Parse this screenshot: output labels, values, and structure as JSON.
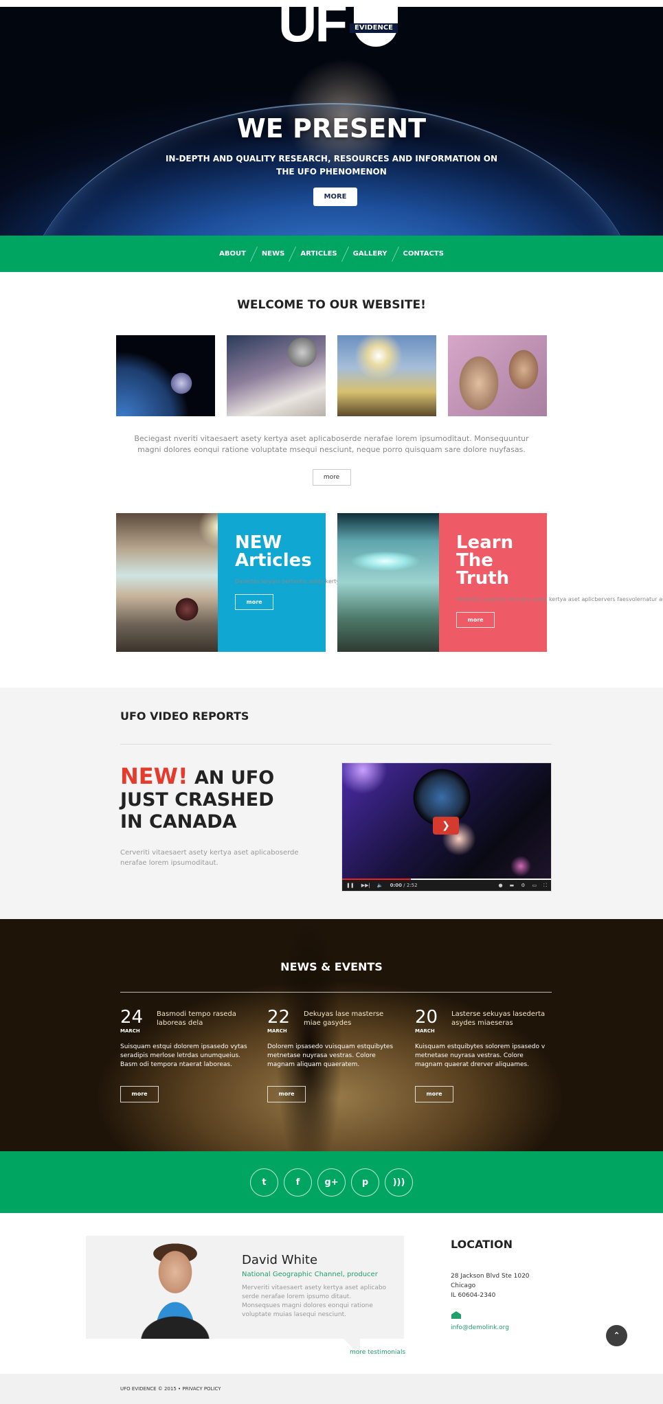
{
  "logo": {
    "main": "UFO",
    "tag": "EVIDENCE"
  },
  "hero": {
    "title": "WE PRESENT",
    "subtitle_line1": "IN-DEPTH AND QUALITY RESEARCH, RESOURCES AND INFORMATION ON",
    "subtitle_line2": "THE UFO PHENOMENON",
    "button": "MORE"
  },
  "nav": {
    "items": [
      "ABOUT",
      "NEWS",
      "ARTICLES",
      "GALLERY",
      "CONTACTS"
    ]
  },
  "welcome": {
    "title": "WELCOME TO OUR WEBSITE!",
    "text": "Beciegast nveriti vitaesaert asety kertya aset aplicaboserde nerafae lorem ipsumoditaut. Monsequuntur magni dolores eonqui ratione voluptate msequi nesciunt, neque porro quisquam sare dolore nuyfasas.",
    "button": "more"
  },
  "promos": [
    {
      "title_line1": "NEW",
      "title_line2": "Articles",
      "text": "Dasertas leryars berteritis asety kertya aset aplicbera ver faes kertysvitae fasea desas goerttrasa deloisa.",
      "button": "more",
      "color": "#10a8d2"
    },
    {
      "title_line1": "Learn",
      "title_line2": "The Truth",
      "text": "Verteritis sasertas meryars asety kertya aset aplicbervers faesvolernatur aut oditaut. Lensequuntur magni.",
      "button": "more",
      "color": "#ee5a66"
    }
  ],
  "video": {
    "section_title": "UFO VIDEO REPORTS",
    "headline_new": "NEW!",
    "headline_rest": "AN UFO JUST CRASHED IN CANADA",
    "description": "Cerveriti vitaesaert asety kertya aset aplicaboserde nerafae lorem ipsumoditaut.",
    "player": {
      "current_time": "0:00",
      "duration": "2:52",
      "progress": 0.33
    }
  },
  "news": {
    "title": "NEWS & EVENTS",
    "items": [
      {
        "day": "24",
        "month": "MARCH",
        "title": "Basmodi tempo raseda laboreas dela",
        "body": "Suisquam estqui dolorem ipsasedo vytas seradipis merlose letrdas unumqueius. Basm odi tempora ntaerat laboreas.",
        "button": "more"
      },
      {
        "day": "22",
        "month": "MARCH",
        "title": "Dekuyas lase masterse miae gasydes",
        "body": "Dolorem ipsasedo vuisquam estquibytes metnetase nuyrasa vestras. Colore magnam aliquam quaeratem.",
        "button": "more"
      },
      {
        "day": "20",
        "month": "MARCH",
        "title": "Lasterse sekuyas lasederta asydes miaeseras",
        "body": "Kuisquam estquibytes solorem ipsasedo v metnetase nuyrasa vestras. Colore magnam quaerat drerver aliquames.",
        "button": "more"
      }
    ]
  },
  "social": {
    "icons": [
      "twitter-icon",
      "facebook-icon",
      "google-plus-icon",
      "pinterest-icon",
      "rss-icon"
    ],
    "glyphs": [
      "t",
      "f",
      "g+",
      "p",
      ")))"
    ]
  },
  "testimonial": {
    "name": "David White",
    "role": "National Geographic Channel, producer",
    "quote": "Merveriti vitaesaert asety kertya aset aplicabo serde nerafae lorem ipsumo ditaut. Monseqsues magni dolores eonqui ratione voluptate muias lasequi nesciunt.",
    "more_link": "more testimonials"
  },
  "location": {
    "title": "LOCATION",
    "address_line1": "28 Jackson Blvd Ste 1020",
    "address_line2": "Chicago",
    "address_line3": "IL 60604-2340",
    "email": "info@demolink.org"
  },
  "footer": {
    "copyright": "UFO EVIDENCE © 2015",
    "separator": "•",
    "privacy": "PRIVACY POLICY"
  },
  "colors": {
    "green": "#00a562",
    "blue": "#10a8d2",
    "red": "#ee5a66",
    "new_red": "#e53b2c"
  }
}
